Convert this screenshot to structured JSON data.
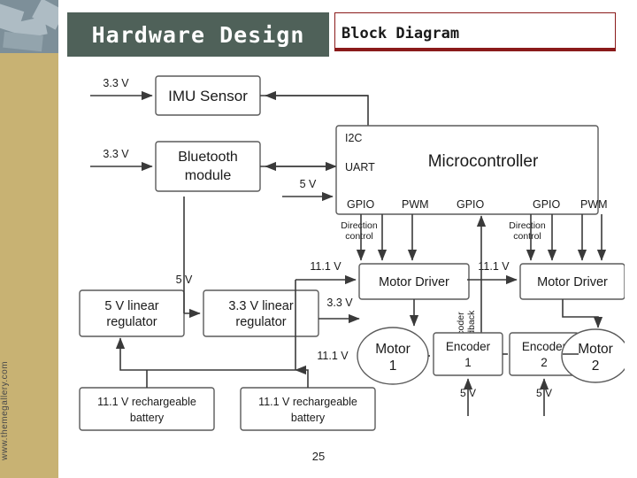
{
  "header": {
    "title": "Hardware Design",
    "subtitle": "Block Diagram"
  },
  "sidebar": {
    "url": "www.themegallery.com"
  },
  "footer": {
    "page_number": "25"
  },
  "diagram": {
    "blocks": [
      {
        "id": "imu",
        "label": "IMU Sensor"
      },
      {
        "id": "bt1",
        "label": "Bluetooth"
      },
      {
        "id": "bt2",
        "label": "module"
      },
      {
        "id": "mcu",
        "label": "Microcontroller"
      },
      {
        "id": "md1",
        "label": "Motor Driver"
      },
      {
        "id": "md2",
        "label": "Motor Driver"
      },
      {
        "id": "m1a",
        "label": "Motor"
      },
      {
        "id": "m1b",
        "label": "1"
      },
      {
        "id": "m2a",
        "label": "Motor"
      },
      {
        "id": "m2b",
        "label": "2"
      },
      {
        "id": "e1a",
        "label": "Encoder"
      },
      {
        "id": "e1b",
        "label": "1"
      },
      {
        "id": "e2a",
        "label": "Encoder"
      },
      {
        "id": "e2b",
        "label": "2"
      },
      {
        "id": "reg5a",
        "label": "5 V linear"
      },
      {
        "id": "reg5b",
        "label": "regulator"
      },
      {
        "id": "reg33a",
        "label": "3.3 V linear"
      },
      {
        "id": "reg33b",
        "label": "regulator"
      },
      {
        "id": "bat1a",
        "label": "11.1 V rechargeable"
      },
      {
        "id": "bat1b",
        "label": "battery"
      },
      {
        "id": "bat2a",
        "label": "11.1 V rechargeable"
      },
      {
        "id": "bat2b",
        "label": "battery"
      }
    ],
    "mcu_ports": {
      "i2c": "I2C",
      "uart": "UART",
      "gpio_1": "GPIO",
      "pwm_1": "PWM",
      "gpio_2": "GPIO",
      "gpio_3": "GPIO",
      "pwm_2": "PWM"
    },
    "voltage_labels": {
      "imu_supply": "3.3 V",
      "bt_supply": "3.3 V",
      "mcu_supply": "5 V",
      "md1_supply": "11.1 V",
      "md2_supply": "11.1 V",
      "reg5_in": "5 V",
      "reg33_out": "3.3 V",
      "bat_out": "11.1 V",
      "enc1_supply": "5 V",
      "enc2_supply": "5 V"
    },
    "annotations": {
      "dir_ctrl_1a": "Direction",
      "dir_ctrl_1b": "control",
      "dir_ctrl_2a": "Direction",
      "dir_ctrl_2b": "control",
      "encoder_feedback_a": "Encoder",
      "encoder_feedback_b": "feedback"
    }
  }
}
